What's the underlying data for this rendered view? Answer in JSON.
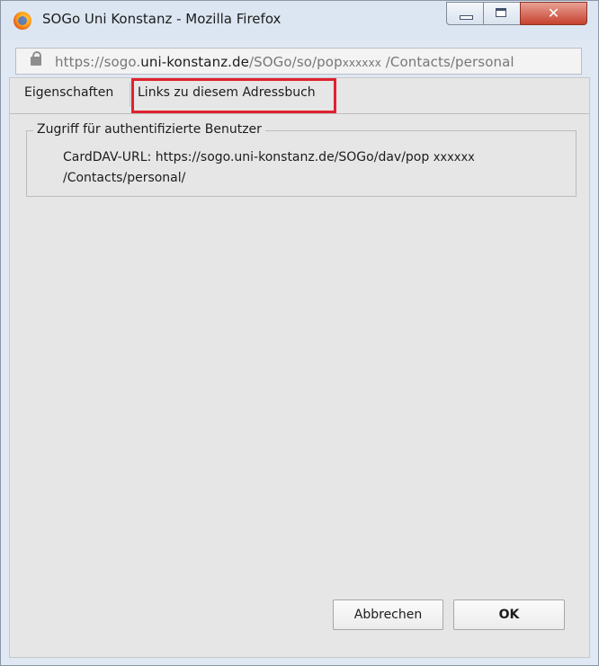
{
  "window": {
    "title": "SOGo Uni Konstanz - Mozilla Firefox",
    "close_symbol": "✕"
  },
  "urlbar": {
    "prefix": "https://sogo.",
    "domain": "uni-konstanz.de",
    "path": "/SOGo/so/pop",
    "redacted_user": "xxxxxx",
    "suffix": " /Contacts/personal"
  },
  "tabs": [
    {
      "label": "Eigenschaften"
    },
    {
      "label": "Links zu diesem Adressbuch"
    }
  ],
  "fieldset": {
    "legend": "Zugriff für authentifizierte Benutzer",
    "carddav_prefix": "CardDAV-URL: https://sogo.uni-konstanz.de/SOGo/dav/pop ",
    "carddav_user": "xxxxxx",
    "carddav_suffix": "/Contacts/personal/"
  },
  "buttons": {
    "cancel": "Abbrechen",
    "ok": "OK"
  },
  "colors": {
    "highlight": "#e0212e",
    "close_button": "#c7412f"
  }
}
